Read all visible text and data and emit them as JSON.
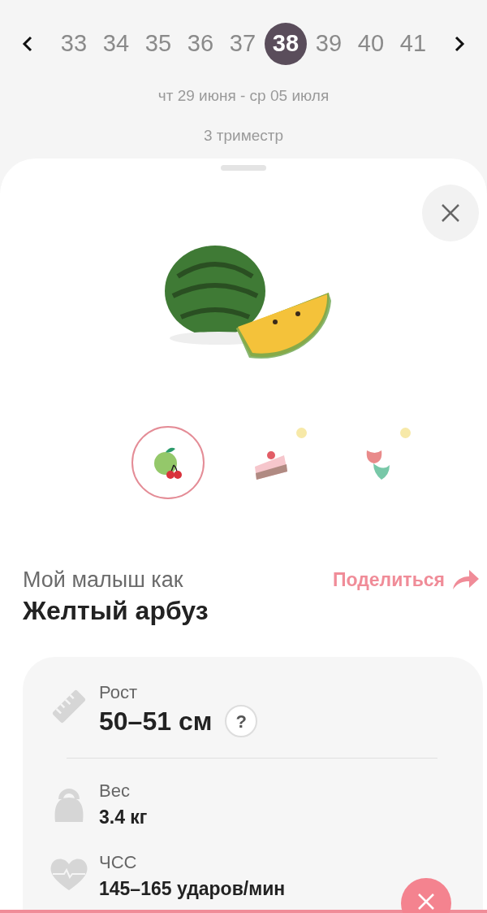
{
  "weeks": [
    {
      "label": "33",
      "selected": false
    },
    {
      "label": "34",
      "selected": false
    },
    {
      "label": "35",
      "selected": false
    },
    {
      "label": "36",
      "selected": false
    },
    {
      "label": "37",
      "selected": false
    },
    {
      "label": "38",
      "selected": true
    },
    {
      "label": "39",
      "selected": false
    },
    {
      "label": "40",
      "selected": false
    },
    {
      "label": "41",
      "selected": false
    }
  ],
  "date_range": "чт 29 июня - ср 05 июля",
  "trimester": "3 триместр",
  "categories": [
    {
      "kind": "fruit",
      "selected": true,
      "badge": false
    },
    {
      "kind": "dessert",
      "selected": false,
      "badge": true
    },
    {
      "kind": "flower",
      "selected": false,
      "badge": true
    }
  ],
  "comparison": {
    "intro": "Мой малыш как",
    "name": "Желтый арбуз",
    "share": "Поделиться"
  },
  "stats": [
    {
      "kind": "height",
      "label": "Рост",
      "value": "50–51 см",
      "help": true,
      "help_label": "?"
    },
    {
      "kind": "weight",
      "label": "Вес",
      "value": "3.4 кг",
      "help": false
    },
    {
      "kind": "heart",
      "label": "ЧСС",
      "value": "145–165 ударов/мин",
      "help": false
    }
  ]
}
